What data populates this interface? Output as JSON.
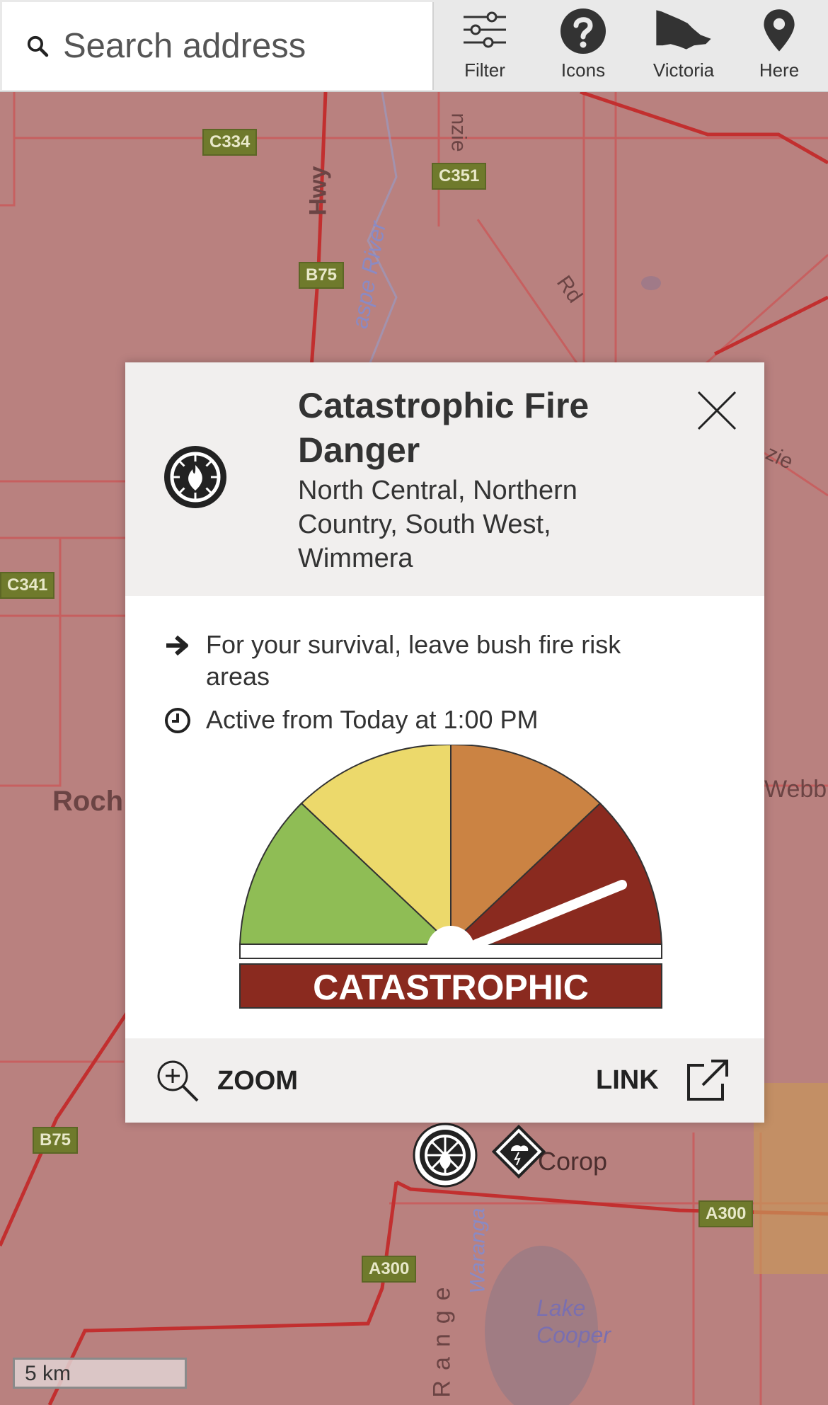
{
  "search": {
    "placeholder": "Search address"
  },
  "toolbar": {
    "filter_label": "Filter",
    "icons_label": "Icons",
    "victoria_label": "Victoria",
    "here_label": "Here"
  },
  "map": {
    "road_shields": [
      "C334",
      "C351",
      "B75",
      "C341",
      "B75",
      "A300",
      "A300"
    ],
    "labels": {
      "hwy": "Hwy",
      "river": "aspe River",
      "rd": "Rd",
      "roch": "Roch",
      "webb": "Webb",
      "corop": "Corop",
      "lake": "Lake",
      "cooper": "Cooper",
      "range": "Range",
      "waranga": "Waranga",
      "nzie": "nzie",
      "zie": "zie"
    },
    "scale": "5 km",
    "overlay_color": "#b9817f"
  },
  "popup": {
    "title": "Catastrophic Fire Danger",
    "regions": "North Central, Northern Country, South West, Wimmera",
    "advice": "For your survival, leave bush fire risk areas",
    "active": "Active from Today at 1:00 PM",
    "gauge_label": "CATASTROPHIC",
    "gauge_level": "catastrophic",
    "gauge_colors": [
      "#8fbd55",
      "#ecd96b",
      "#cb8343",
      "#8a2a1f"
    ],
    "zoom_label": "ZOOM",
    "link_label": "LINK"
  }
}
